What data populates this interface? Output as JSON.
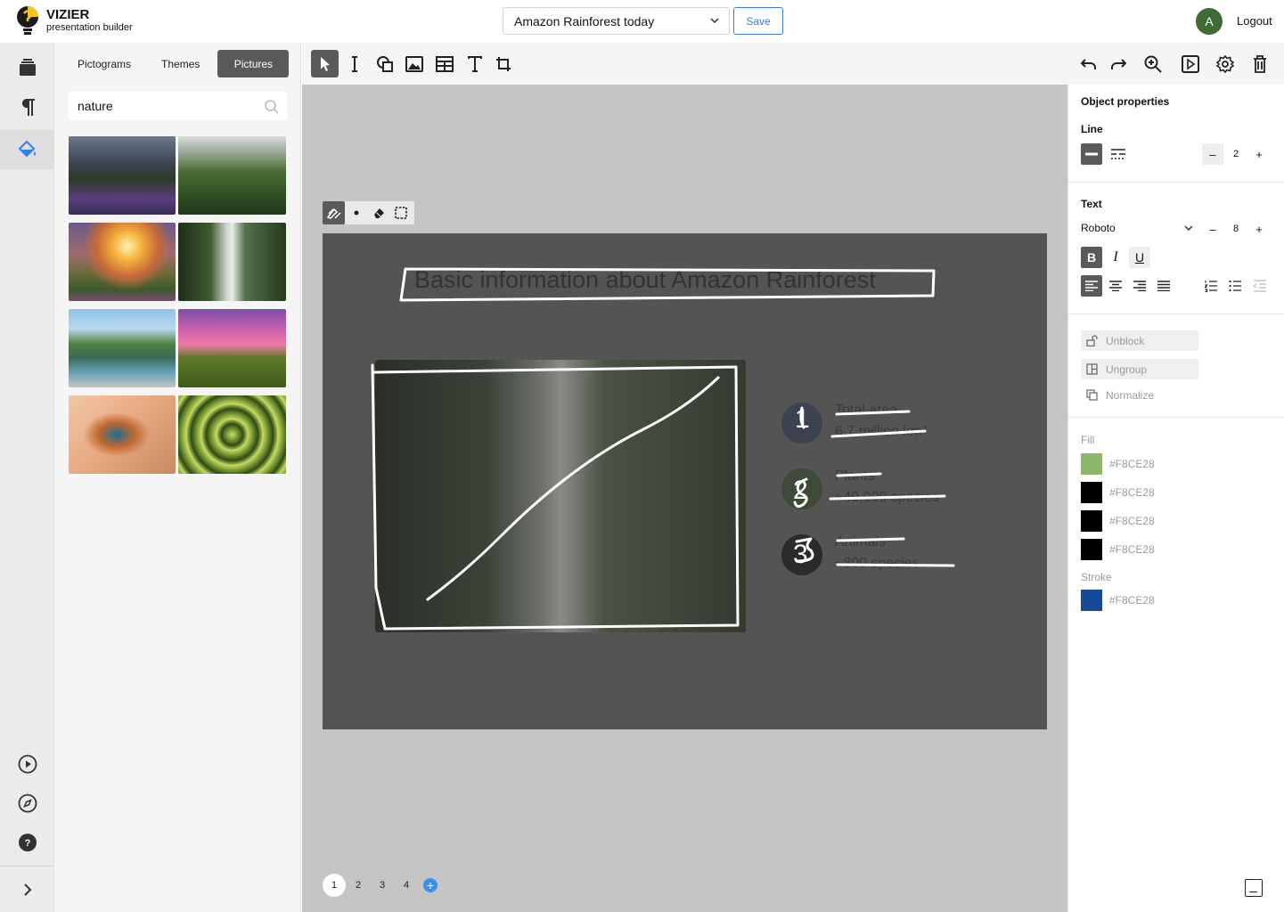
{
  "app": {
    "title": "VIZIER",
    "subtitle": "presentation builder"
  },
  "header": {
    "document_title": "Amazon Rainforest today",
    "save_label": "Save",
    "avatar_initial": "A",
    "logout_label": "Logout"
  },
  "left_rail": {
    "items": [
      "layers-icon",
      "paragraph-icon",
      "paint-bucket-icon"
    ],
    "bottom_items": [
      "play-icon",
      "compass-icon",
      "help-icon"
    ],
    "collapse": "chevron-right-icon"
  },
  "panel": {
    "tabs": [
      {
        "label": "Pictograms"
      },
      {
        "label": "Themes"
      },
      {
        "label": "Pictures",
        "active": true
      }
    ],
    "search": {
      "value": "nature",
      "placeholder": "Search"
    },
    "pictures": [
      {
        "name": "purple-flowers-mountains"
      },
      {
        "name": "forest-canopy"
      },
      {
        "name": "sunset-mountains"
      },
      {
        "name": "waterfall-forest"
      },
      {
        "name": "lake-woman-pier"
      },
      {
        "name": "pink-sky-hill"
      },
      {
        "name": "kingfisher-bird"
      },
      {
        "name": "spiral-succulent"
      }
    ]
  },
  "toolbar": {
    "tools": [
      "select-icon",
      "text-cursor-icon",
      "shapes-icon",
      "image-icon",
      "table-icon",
      "text-icon",
      "crop-icon"
    ],
    "right_tools": [
      "undo-icon",
      "redo-icon",
      "zoom-icon",
      "present-icon",
      "settings-icon",
      "trash-icon"
    ]
  },
  "draw_tools": [
    "pen-icon",
    "dot-icon",
    "eraser-icon",
    "selection-icon"
  ],
  "slide": {
    "title": "Basic information about Amazon Rainforest",
    "facts": [
      {
        "number": "1",
        "label": "Total area",
        "value": "6.7 million km²"
      },
      {
        "number": "2",
        "label": "Plants",
        "value": "~40,000 species"
      },
      {
        "number": "3",
        "label": "Animals",
        "value": "~800 species"
      }
    ]
  },
  "pages": {
    "items": [
      "1",
      "2",
      "3",
      "4"
    ],
    "active": "1",
    "add_label": "+"
  },
  "properties": {
    "title": "Object properties",
    "line": {
      "label": "Line",
      "width": "2"
    },
    "text": {
      "label": "Text",
      "font": "Roboto",
      "size": "8"
    },
    "actions": {
      "unblock": "Unblock",
      "ungroup": "Ungroup",
      "normalize": "Normalize"
    },
    "fill": {
      "label": "Fill",
      "colors": [
        {
          "swatch": "#8DB86B",
          "hex": "#F8CE28"
        },
        {
          "swatch": "#000000",
          "hex": "#F8CE28"
        },
        {
          "swatch": "#000000",
          "hex": "#F8CE28"
        },
        {
          "swatch": "#000000",
          "hex": "#F8CE28"
        }
      ]
    },
    "stroke": {
      "label": "Stroke",
      "colors": [
        {
          "swatch": "#154A9A",
          "hex": "#F8CE28"
        }
      ]
    }
  }
}
